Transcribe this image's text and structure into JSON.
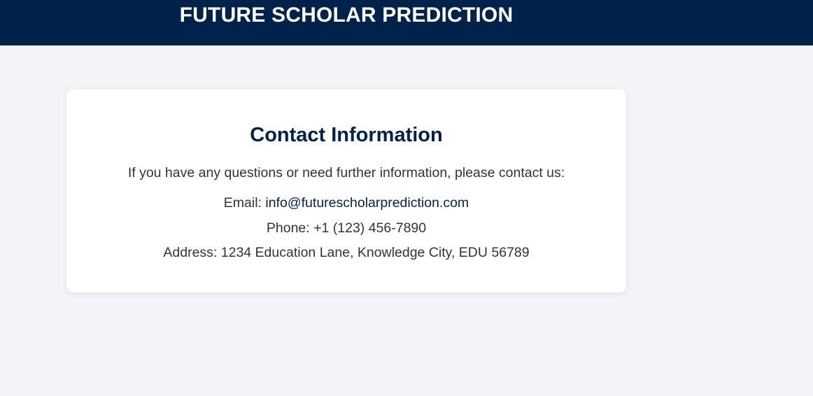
{
  "header": {
    "title": "FUTURE SCHOLAR PREDICTION"
  },
  "contact": {
    "title": "Contact Information",
    "intro": "If you have any questions or need further information, please contact us:",
    "email_label": "Email:",
    "email_value": "info@futurescholarprediction.com",
    "phone_label": "Phone:",
    "phone_value": "+1 (123) 456-7890",
    "address_label": "Address:",
    "address_value": "1234 Education Lane, Knowledge City, EDU 56789"
  },
  "colors": {
    "header_bg": "#00224b",
    "page_bg": "#f3f3f8",
    "title_color": "#00224b",
    "text_color": "#333333"
  }
}
